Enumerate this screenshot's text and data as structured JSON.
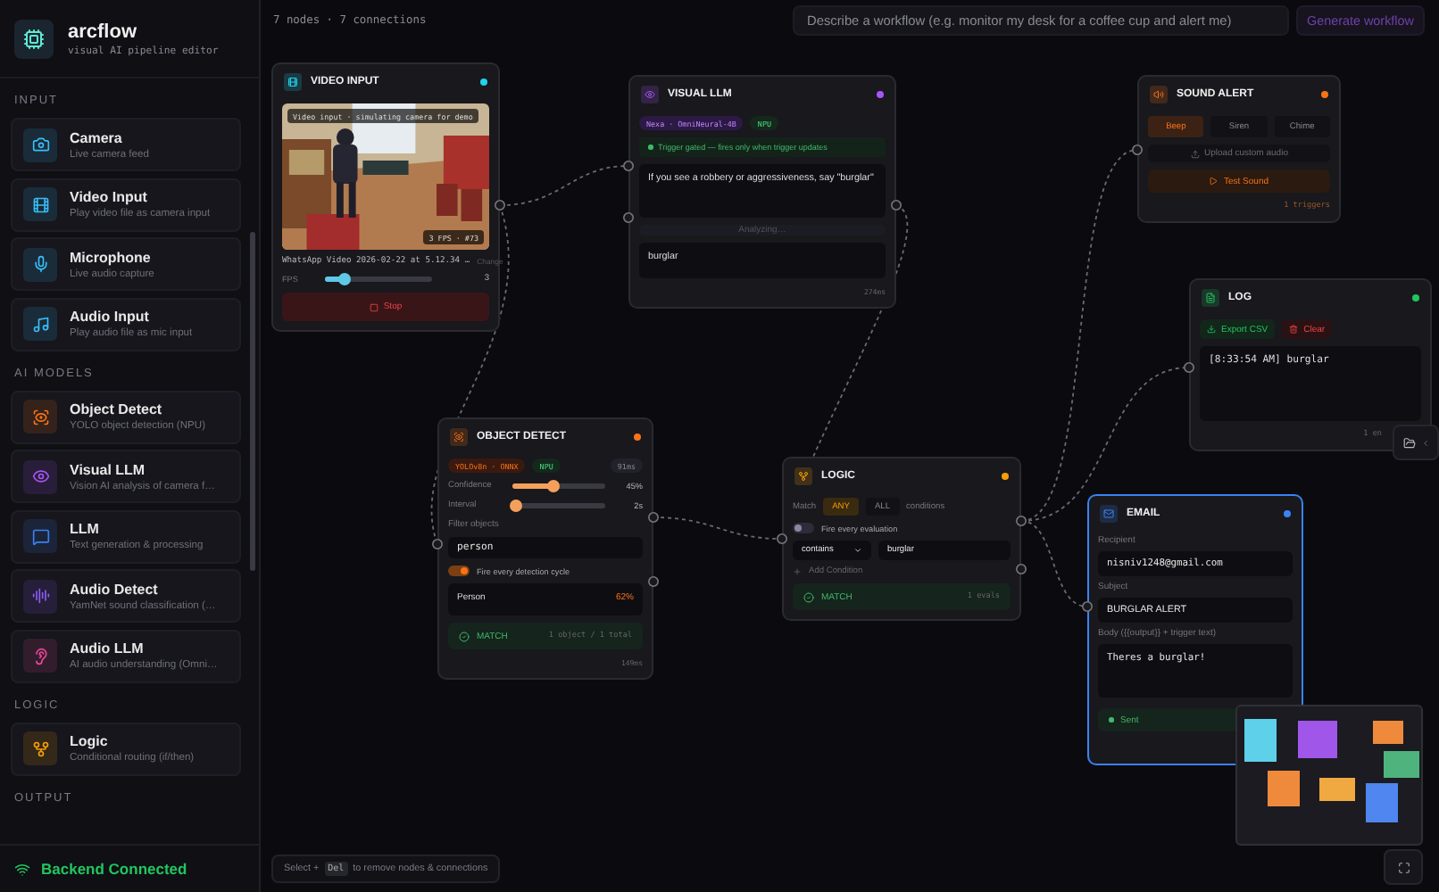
{
  "app": {
    "name": "arcflow",
    "tagline": "visual AI pipeline editor"
  },
  "sidebar": {
    "sections": [
      {
        "title": "INPUT",
        "items": [
          {
            "kind": "camera",
            "name": "Camera",
            "description": "Live camera feed",
            "color": "#38bdf8"
          },
          {
            "kind": "video",
            "name": "Video Input",
            "description": "Play video file as camera input",
            "color": "#38bdf8"
          },
          {
            "kind": "mic",
            "name": "Microphone",
            "description": "Live audio capture",
            "color": "#38bdf8"
          },
          {
            "kind": "audio",
            "name": "Audio Input",
            "description": "Play audio file as mic input",
            "color": "#38bdf8"
          }
        ]
      },
      {
        "title": "AI MODELS",
        "items": [
          {
            "kind": "detect",
            "name": "Object Detect",
            "description": "YOLO object detection (NPU)",
            "color": "#f97316"
          },
          {
            "kind": "vision",
            "name": "Visual LLM",
            "description": "Vision AI analysis of camera f…",
            "color": "#a855f7"
          },
          {
            "kind": "chat",
            "name": "LLM",
            "description": "Text generation & processing",
            "color": "#3b82f6"
          },
          {
            "kind": "wave",
            "name": "Audio Detect",
            "description": "YamNet sound classification (…",
            "color": "#8b5cf6"
          },
          {
            "kind": "ear",
            "name": "Audio LLM",
            "description": "AI audio understanding (Omni…",
            "color": "#ec4899"
          }
        ]
      },
      {
        "title": "LOGIC",
        "items": [
          {
            "kind": "branch",
            "name": "Logic",
            "description": "Conditional routing (if/then)",
            "color": "#f59e0b"
          }
        ]
      },
      {
        "title": "OUTPUT"
      }
    ],
    "status": "Backend Connected"
  },
  "toolbar": {
    "stats": "7 nodes · 7 connections",
    "prompt": {
      "placeholder": "Describe a workflow (e.g. monitor my desk for a coffee cup and alert me)"
    },
    "generate_button": "Generate workflow"
  },
  "nodes": [
    {
      "kind": "video_input",
      "title": "VIDEO INPUT",
      "color": "#22d3ee",
      "selected": false,
      "overlay_label": "Video input · simulating camera for demo",
      "frame_badge": "3 FPS · #73",
      "file": "WhatsApp Video 2026-02-22 at 5.12.34 …",
      "change_link": "Change",
      "fps": {
        "label": "FPS",
        "level": 0.17,
        "reading": "3"
      },
      "stop_button": "Stop"
    },
    {
      "kind": "visual_llm",
      "title": "VISUAL LLM",
      "color": "#a855f7",
      "selected": false,
      "model_badge": "Nexa · OmniNeural-4B",
      "device_badge": "NPU",
      "gate_note": "Trigger gated — fires only when trigger updates",
      "prompt": "If you see a robbery or aggressiveness, say \"burglar\"",
      "run_button": {
        "label": "Analyzing…",
        "disabled": true
      },
      "output": "burglar",
      "latency": "274ms"
    },
    {
      "kind": "sound_alert",
      "title": "SOUND ALERT",
      "color": "#f97316",
      "selected": false,
      "sounds": [
        {
          "label": "Beep",
          "selected": true
        },
        {
          "label": "Siren",
          "selected": false
        },
        {
          "label": "Chime",
          "selected": false
        }
      ],
      "upload": "Upload custom audio",
      "test_button": "Test Sound",
      "footer": "1 triggers"
    },
    {
      "kind": "log",
      "title": "LOG",
      "color": "#22c55e",
      "selected": false,
      "export_button": "Export CSV",
      "clear_button": "Clear",
      "entries": [
        "[8:33:54 AM] burglar"
      ],
      "footer": "1 en"
    },
    {
      "kind": "object_detect",
      "title": "OBJECT DETECT",
      "color": "#f97316",
      "selected": false,
      "model_badge": "YOLOv8n · ONNX",
      "device_badge": "NPU",
      "timing_badge": "91ms",
      "sliders": [
        {
          "label": "Confidence",
          "level": 0.45,
          "reading": "45%"
        },
        {
          "label": "Interval",
          "level": 0.05,
          "reading": "2s"
        }
      ],
      "filter": {
        "label": "Filter objects",
        "value": "person"
      },
      "toggle": {
        "label": "Fire every detection cycle",
        "on": true
      },
      "detections": [
        {
          "label": "Person",
          "score": "62%"
        }
      ],
      "match": "MATCH",
      "match_detail": "1 object / 1 total",
      "latency": "149ms"
    },
    {
      "kind": "logic",
      "title": "LOGIC",
      "color": "#f59e0b",
      "selected": false,
      "match_label": "Match",
      "modes": [
        {
          "label": "ANY",
          "selected": true
        },
        {
          "label": "ALL",
          "selected": false
        }
      ],
      "modes_suffix": "conditions",
      "toggle": {
        "label": "Fire every evaluation",
        "on": false
      },
      "condition": {
        "operator": "contains",
        "value": "burglar"
      },
      "add_condition": "Add Condition",
      "match": "MATCH",
      "match_detail": "1 evals"
    },
    {
      "kind": "email",
      "title": "EMAIL",
      "color": "#3b82f6",
      "selected": true,
      "fields": [
        {
          "label": "Recipient",
          "value": "nisniv1248@gmail.com"
        },
        {
          "label": "Subject",
          "value": "BURGLAR ALERT"
        }
      ],
      "body": {
        "label": "Body ({{output}} + trigger text)",
        "value": "Theres a burglar!"
      },
      "status": "Sent"
    }
  ],
  "hint": {
    "before": "Select +",
    "key": "Del",
    "after": "to remove nodes & connections"
  }
}
